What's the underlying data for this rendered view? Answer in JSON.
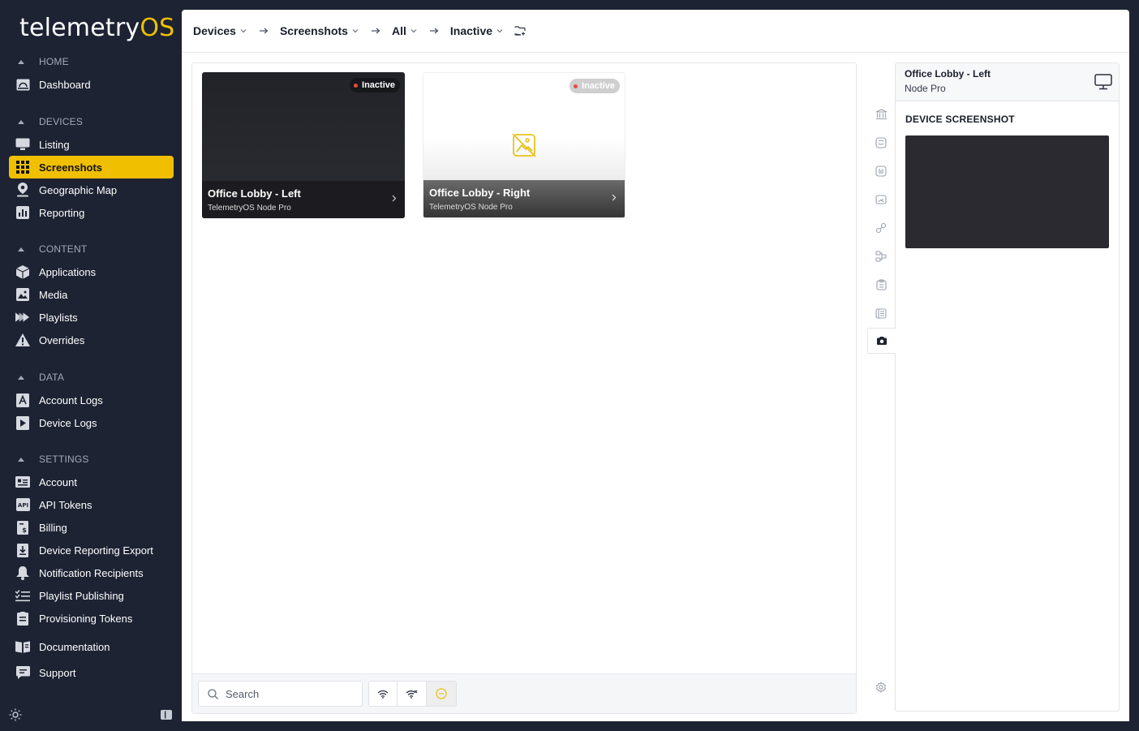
{
  "brand": {
    "name_part1": "telemetry",
    "name_part2": "OS"
  },
  "sidebar": {
    "sections": [
      {
        "heading": "HOME",
        "items": [
          {
            "label": "Dashboard",
            "icon": "dashboard-icon"
          }
        ]
      },
      {
        "heading": "DEVICES",
        "items": [
          {
            "label": "Listing",
            "icon": "monitor-icon"
          },
          {
            "label": "Screenshots",
            "icon": "grid-icon",
            "active": true
          },
          {
            "label": "Geographic Map",
            "icon": "map-pin-icon"
          },
          {
            "label": "Reporting",
            "icon": "bar-chart-icon"
          }
        ]
      },
      {
        "heading": "CONTENT",
        "items": [
          {
            "label": "Applications",
            "icon": "cube-icon"
          },
          {
            "label": "Media",
            "icon": "image-icon"
          },
          {
            "label": "Playlists",
            "icon": "playlist-icon"
          },
          {
            "label": "Overrides",
            "icon": "warning-icon"
          }
        ]
      },
      {
        "heading": "DATA",
        "items": [
          {
            "label": "Account Logs",
            "icon": "account-log-icon"
          },
          {
            "label": "Device Logs",
            "icon": "device-log-icon"
          }
        ]
      },
      {
        "heading": "SETTINGS",
        "items": [
          {
            "label": "Account",
            "icon": "id-card-icon"
          },
          {
            "label": "API Tokens",
            "icon": "api-icon"
          },
          {
            "label": "Billing",
            "icon": "billing-icon"
          },
          {
            "label": "Device Reporting Export",
            "icon": "download-icon"
          },
          {
            "label": "Notification Recipients",
            "icon": "bell-icon"
          },
          {
            "label": "Playlist Publishing",
            "icon": "checklist-icon"
          },
          {
            "label": "Provisioning Tokens",
            "icon": "token-icon"
          }
        ]
      }
    ],
    "extra": [
      {
        "label": "Documentation",
        "icon": "book-icon"
      },
      {
        "label": "Support",
        "icon": "chat-icon"
      }
    ]
  },
  "breadcrumb": {
    "items": [
      "Devices",
      "Screenshots",
      "All",
      "Inactive"
    ]
  },
  "cards": [
    {
      "name": "Office Lobby - Left",
      "model": "TelemetryOS Node Pro",
      "status": "Inactive",
      "has_image": true
    },
    {
      "name": "Office Lobby - Right",
      "model": "TelemetryOS Node Pro",
      "status": "Inactive",
      "has_image": false
    }
  ],
  "search": {
    "placeholder": "Search",
    "value": ""
  },
  "filters": [
    "online-filter",
    "offline-filter",
    "inactive-filter"
  ],
  "details": {
    "device_name": "Office Lobby - Left",
    "device_model": "Node Pro",
    "section_title": "DEVICE SCREENSHOT"
  },
  "colors": {
    "accent": "#f0c000",
    "sidebar_bg": "#1d2333",
    "status_inactive": "#e74c3c"
  }
}
